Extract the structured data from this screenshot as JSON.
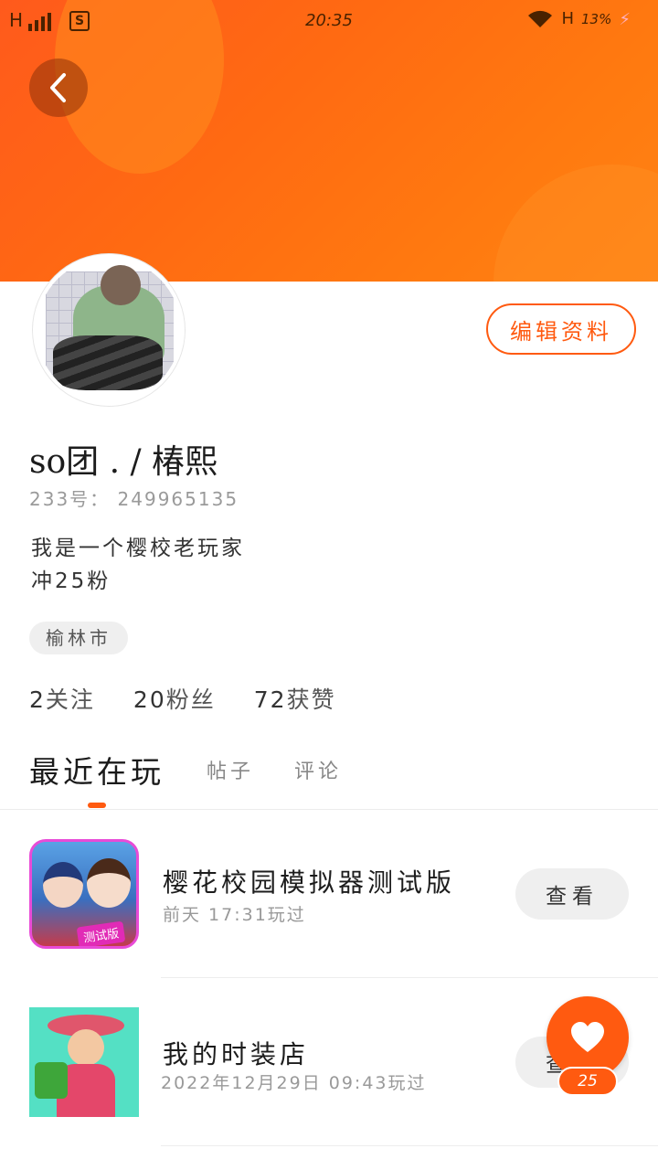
{
  "status_bar": {
    "network_left": "H",
    "time": "20:35",
    "network_right": "H",
    "battery": "13%"
  },
  "profile": {
    "edit_label": "编辑资料",
    "username": "so团 . / 椿熙",
    "user_id": "233号： 249965135",
    "bio_line1": "我是一个樱校老玩家",
    "bio_line2": "冲25粉",
    "location": "榆林市",
    "stats": [
      {
        "num": "2",
        "label": "关注"
      },
      {
        "num": "20",
        "label": "粉丝"
      },
      {
        "num": "72",
        "label": "获赞"
      }
    ]
  },
  "tabs": [
    {
      "label": "最近在玩"
    },
    {
      "label": "帖子"
    },
    {
      "label": "评论"
    }
  ],
  "games": [
    {
      "title": "樱花校园模拟器测试版",
      "played": "前天 17:31玩过",
      "button": "查看",
      "icon_tag": "测试版"
    },
    {
      "title": "我的时装店",
      "played": "2022年12月29日 09:43玩过",
      "button": "查看"
    }
  ],
  "like_fab": {
    "count": "25"
  },
  "colors": {
    "accent": "#ff5a10",
    "banner_start": "#ff5a1c",
    "banner_end": "#ff8314"
  }
}
